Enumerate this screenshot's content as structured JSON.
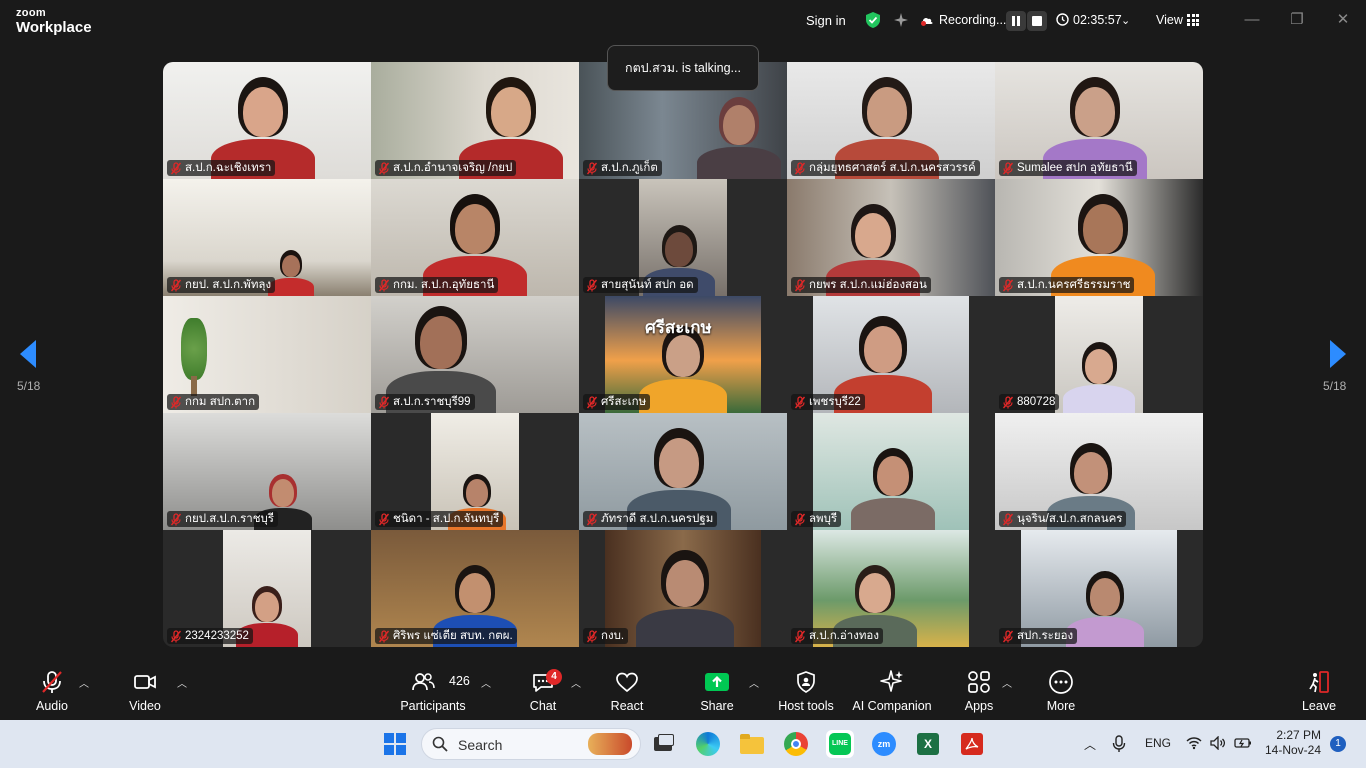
{
  "app": {
    "logo_line1": "zoom",
    "logo_line2": "Workplace"
  },
  "topbar": {
    "sign_in": "Sign in",
    "recording_label": "Recording...",
    "timer": "02:35:57",
    "view_label": "View"
  },
  "talking_indicator": "กตป.สวม. is talking...",
  "pagination": {
    "left": "5/18",
    "right": "5/18"
  },
  "participants": [
    {
      "name": "ส.ป.ก.ฉะเชิงเทรา",
      "muted": true
    },
    {
      "name": "ส.ป.ก.อำนาจเจริญ /กยป",
      "muted": true
    },
    {
      "name": "ส.ป.ก.ภูเก็ต",
      "muted": true
    },
    {
      "name": "กลุ่มยุทธศาสตร์ ส.ป.ก.นครสวรรค์",
      "muted": true
    },
    {
      "name": "Sumalee สปก อุทัยธานี",
      "muted": true
    },
    {
      "name": "กยป. ส.ป.ก.พัทลุง",
      "muted": true
    },
    {
      "name": "กกม. ส.ป.ก.อุทัยธานี",
      "muted": true
    },
    {
      "name": "สายสุนันท์ สปก อด",
      "muted": true
    },
    {
      "name": "กยพร ส.ป.ก.แม่ฮ่องสอน",
      "muted": true
    },
    {
      "name": "ส.ป.ก.นครศรีธรรมราช",
      "muted": true
    },
    {
      "name": "กกม สปก.ตาก",
      "muted": true
    },
    {
      "name": "ส.ป.ก.ราชบุรี99",
      "muted": true
    },
    {
      "name": "ศรีสะเกษ",
      "muted": true
    },
    {
      "name": "เพชรบุรี22",
      "muted": true
    },
    {
      "name": "880728",
      "muted": true
    },
    {
      "name": "กยป.ส.ป.ก.ราชบุรี",
      "muted": true
    },
    {
      "name": "ชนิดา - ส.ป.ก.จันทบุรี",
      "muted": true
    },
    {
      "name": "ภัทราดี ส.ป.ก.นครปฐม",
      "muted": true
    },
    {
      "name": "ลพบุรี",
      "muted": true
    },
    {
      "name": "นุจริน/ส.ป.ก.สกลนคร",
      "muted": true
    },
    {
      "name": "2324233252",
      "muted": true
    },
    {
      "name": "ศิริพร แซ่เตีย สบท. กตผ.",
      "muted": true
    },
    {
      "name": "กงบ.",
      "muted": true
    },
    {
      "name": "ส.ป.ก.อ่างทอง",
      "muted": true
    },
    {
      "name": "สปก.ระยอง",
      "muted": true
    }
  ],
  "tile_overlays": {
    "sisaket_banner": "ศรีสะเกษ"
  },
  "toolbar": {
    "audio": "Audio",
    "video": "Video",
    "participants": "Participants",
    "participants_count": "426",
    "chat": "Chat",
    "chat_badge": "4",
    "react": "React",
    "share": "Share",
    "host_tools": "Host tools",
    "ai_companion": "AI Companion",
    "apps": "Apps",
    "more": "More",
    "leave": "Leave"
  },
  "taskbar": {
    "search_placeholder": "Search",
    "language": "ENG",
    "time": "2:27 PM",
    "date": "14-Nov-24",
    "notifications": "1"
  },
  "colors": {
    "accent_blue": "#2d8cff",
    "share_green": "#00c853",
    "mute_red": "#e02828",
    "leave_red": "#e02828"
  }
}
